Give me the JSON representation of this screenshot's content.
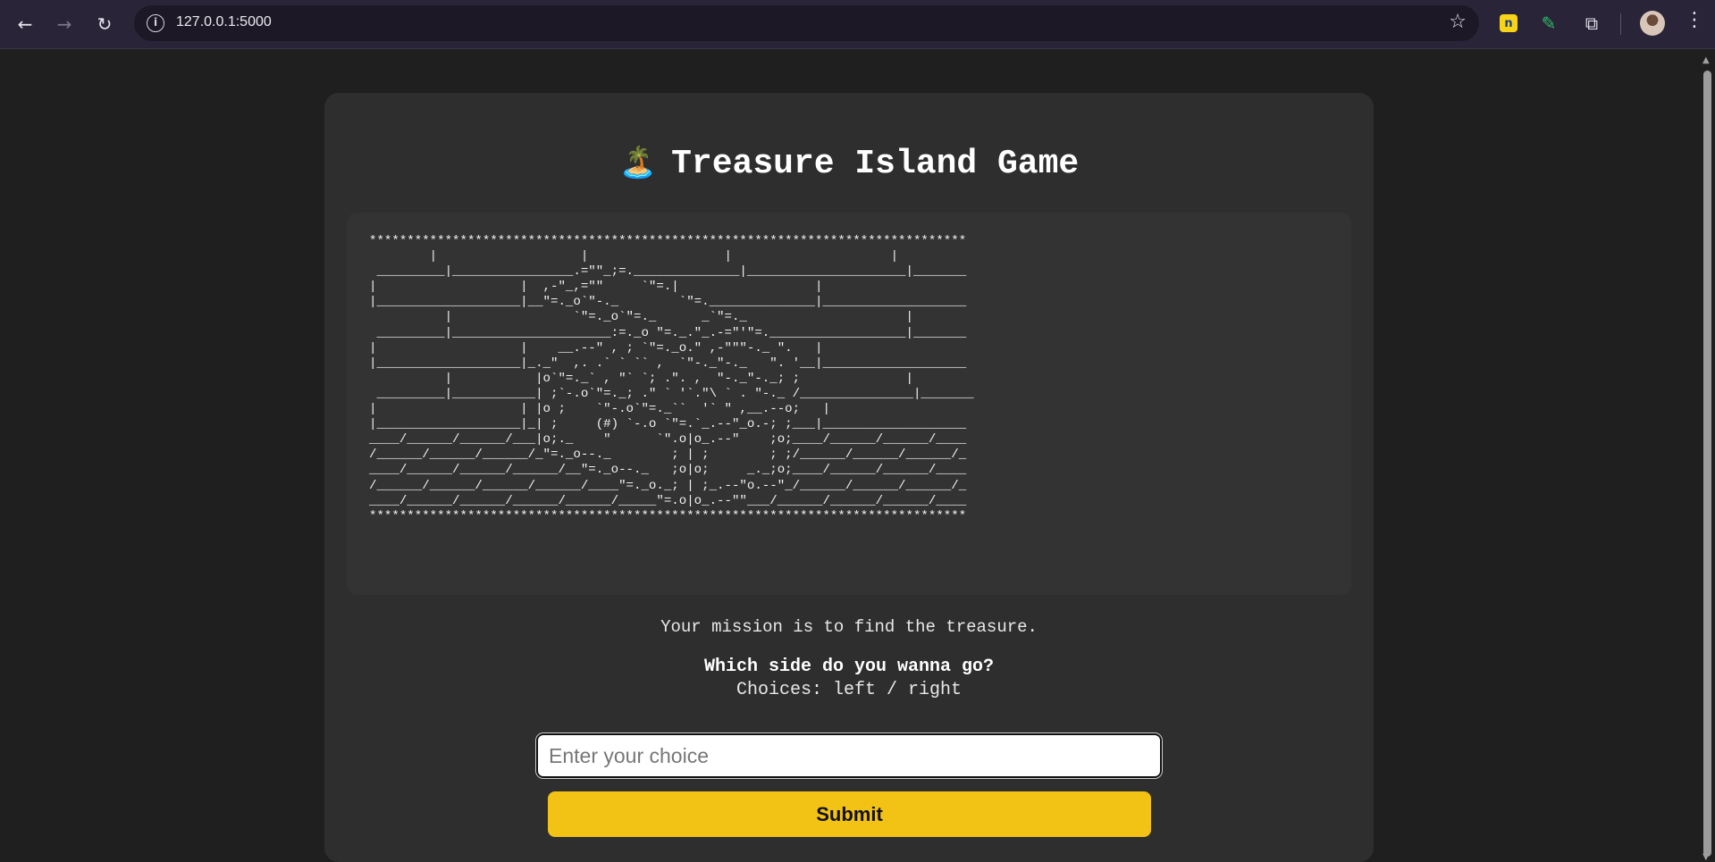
{
  "browser": {
    "url": "127.0.0.1:5000",
    "icons": {
      "back": "arrow-left-icon",
      "forward": "arrow-right-icon",
      "reload": "reload-icon",
      "site_info": "info-icon",
      "bookmark": "star-icon",
      "extension_1": "extension-yellow-icon",
      "extension_2": "pen-icon",
      "extensions": "puzzle-icon",
      "menu": "kebab-menu-icon"
    }
  },
  "game": {
    "title": "Treasure Island Game",
    "title_emoji": "🏝️",
    "ascii_art": "*******************************************************************************\n        |                   |                  |                     |\n _________|________________.=\"\"_;=.______________|_____________________|_______\n|                   |  ,-\"_,=\"\"     `\"=.|                  |\n|___________________|__\"=._o`\"-._        `\"=.______________|___________________\n          |                `\"=._o`\"=._      _`\"=._                     |\n _________|_____________________:=._o \"=._.\"_.-=\"'\"=.__________________|_______\n|                   |    __.--\" , ; `\"=._o.\" ,-\"\"\"-._ \".   |\n|___________________|_._\"  ,. .` ` `` ,  `\"-._\"-._   \". '__|___________________\n          |           |o`\"=._` , \"` `; .\". ,  \"-._\"-._; ;              |\n _________|___________| ;`-.o`\"=._; .\" ` '`.\"\\ ` . \"-._ /_______________|_______\n|                   | |o ;    `\"-.o`\"=._``  '` \" ,__.--o;   |\n|___________________|_| ;     (#) `-.o `\"=.`_.--\"_o.-; ;___|___________________\n____/______/______/___|o;._    \"      `\".o|o_.--\"    ;o;____/______/______/____\n/______/______/______/_\"=._o--._        ; | ;        ; ;/______/______/______/_\n____/______/______/______/__\"=._o--._   ;o|o;     _._;o;____/______/______/____\n/______/______/______/______/____\"=._o._; | ;_.--\"o.--\"_/______/______/______/_\n____/______/______/______/______/_____\"=.o|o_.--\"\"___/______/______/______/____\n*******************************************************************************",
    "mission": "Your mission is to find the treasure.",
    "question": "Which side do you wanna go?",
    "choices": "Choices: left / right",
    "input_placeholder": "Enter your choice",
    "input_value": "",
    "submit_label": "Submit"
  },
  "colors": {
    "page_bg": "#1f1f1f",
    "card_bg": "#2e2e2e",
    "art_bg": "#333333",
    "button": "#f2c315",
    "chrome": "#2a2438"
  }
}
